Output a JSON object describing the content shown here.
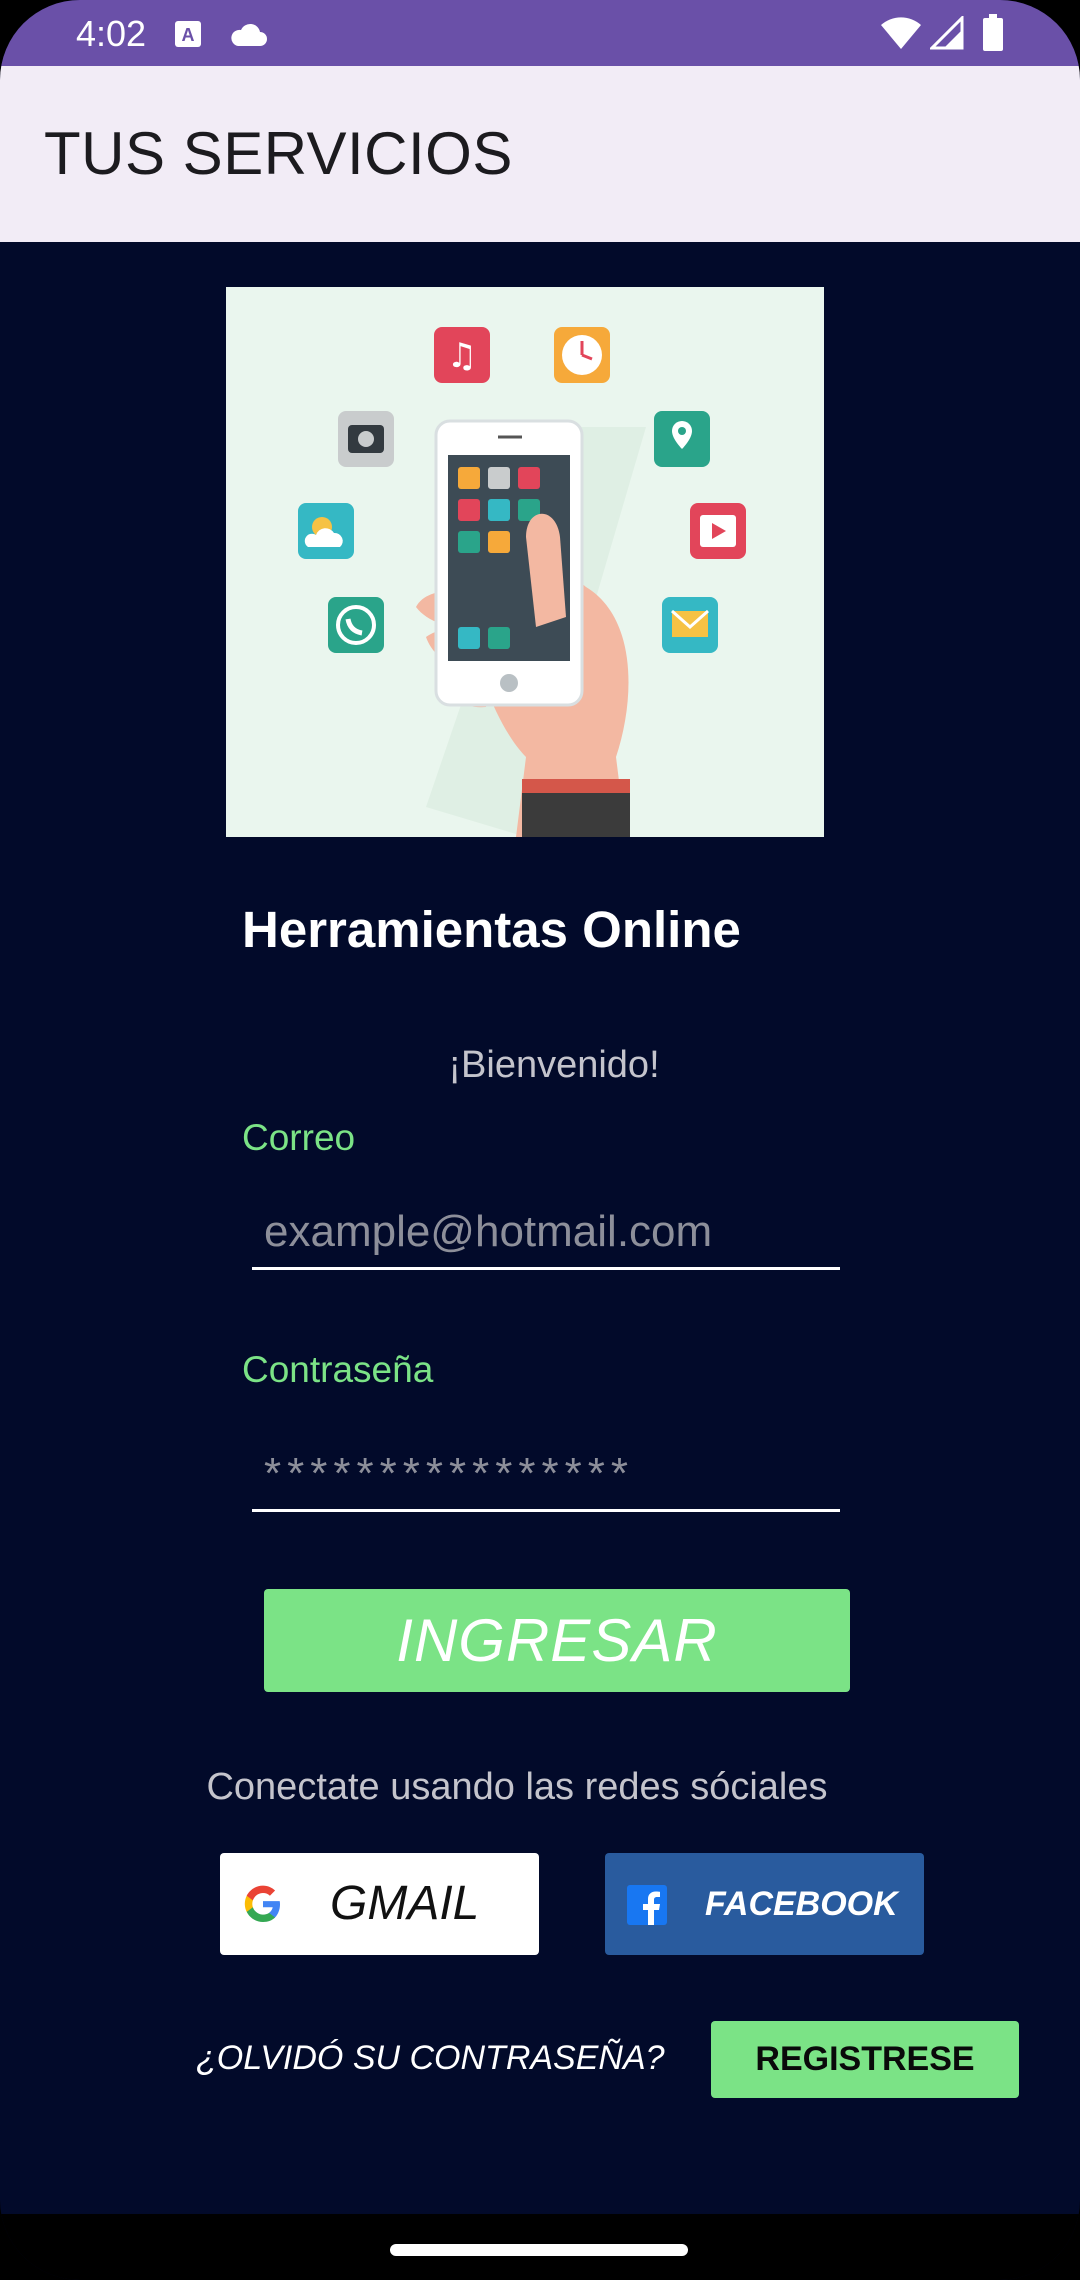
{
  "status_bar": {
    "time": "4:02",
    "icons": [
      "keyboard-a-icon",
      "cloud-icon",
      "wifi-icon",
      "signal-icon",
      "battery-icon"
    ]
  },
  "app_bar": {
    "title": "TUS SERVICIOS"
  },
  "hero": {
    "image": "hand-holding-phone-with-app-icons-illustration"
  },
  "main": {
    "heading": "Herramientas Online",
    "welcome": "¡Bienvenido!",
    "email_label": "Correo",
    "email_placeholder": "example@hotmail.com",
    "password_label": "Contraseña",
    "password_placeholder": "****************",
    "login_button": "INGRESAR",
    "social_caption": "Conectate usando las redes sóciales",
    "gmail_button": "GMAIL",
    "facebook_button": "FACEBOOK",
    "forgot_password": "¿OLVIDÓ SU CONTRASEÑA?",
    "register_button": "REGISTRESE"
  },
  "colors": {
    "status_bar": "#6a50a8",
    "app_bar": "#f2ecf6",
    "background": "#020a2a",
    "accent_green": "#7be386",
    "facebook_blue": "#295b9e"
  }
}
